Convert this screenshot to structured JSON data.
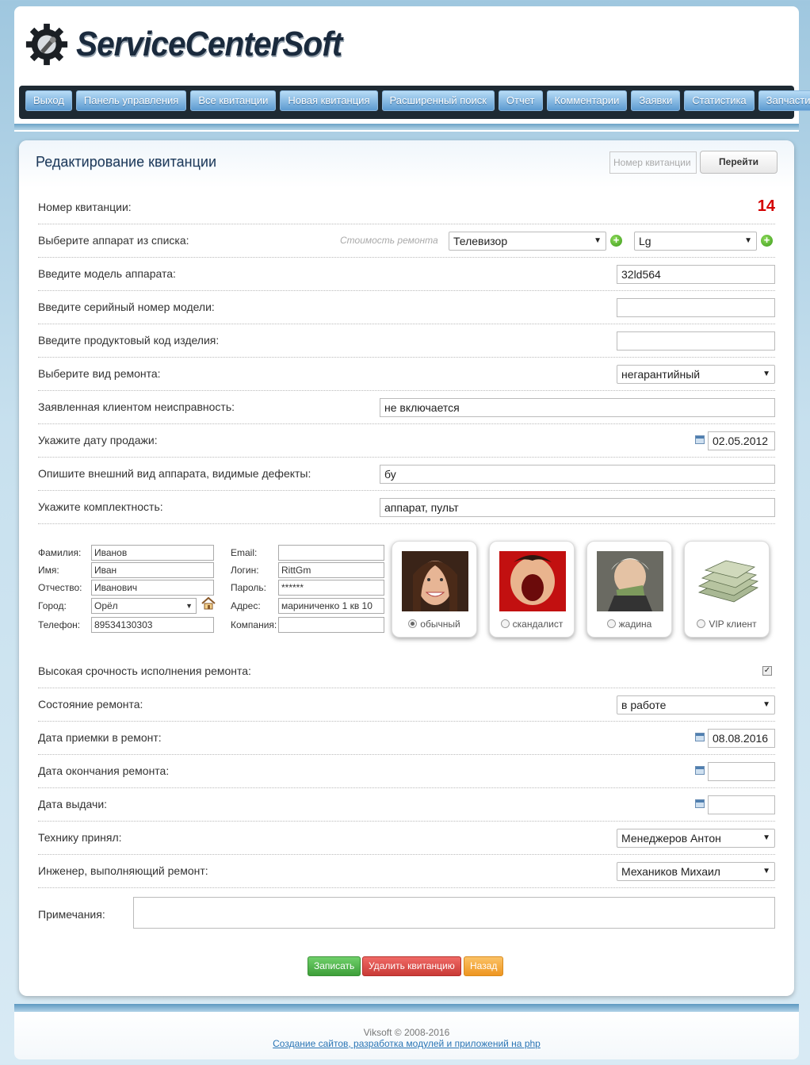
{
  "header": {
    "logo_text": "ServiceCenterSoft"
  },
  "nav": [
    "Выход",
    "Панель управления",
    "Все квитанции",
    "Новая квитанция",
    "Расширенный поиск",
    "Отчет",
    "Комментарии",
    "Заявки",
    "Статистика",
    "Запчасти"
  ],
  "page": {
    "title": "Редактирование квитанции",
    "jump_placeholder": "Номер квитанции",
    "jump_button": "Перейти"
  },
  "form": {
    "receipt_label": "Номер квитанции:",
    "receipt_number": "14",
    "device_label": "Выберите аппарат из списка:",
    "repair_cost_hint": "Стоимость ремонта",
    "device_type": "Телевизор",
    "device_brand": "Lg",
    "model_label": "Введите модель аппарата:",
    "model_value": "32ld564",
    "serial_label": "Введите серийный номер модели:",
    "serial_value": "",
    "product_code_label": "Введите продуктовый код изделия:",
    "product_code_value": "",
    "repair_type_label": "Выберите вид ремонта:",
    "repair_type_value": "негарантийный",
    "fault_label": "Заявленная клиентом неисправность:",
    "fault_value": "не включается",
    "sale_date_label": "Укажите дату продажи:",
    "sale_date_value": "02.05.2012",
    "appearance_label": "Опишите внешний вид аппарата, видимые дефекты:",
    "appearance_value": "бу",
    "kit_label": "Укажите комплектность:",
    "kit_value": "аппарат, пульт"
  },
  "client": {
    "surname_label": "Фамилия:",
    "surname": "Иванов",
    "name_label": "Имя:",
    "name": "Иван",
    "patronymic_label": "Отчество:",
    "patronymic": "Иванович",
    "city_label": "Город:",
    "city": "Орёл",
    "phone_label": "Телефон:",
    "phone": "89534130303",
    "email_label": "Email:",
    "email": "",
    "login_label": "Логин:",
    "login": "RittGm",
    "password_label": "Пароль:",
    "password": "******",
    "address_label": "Адрес:",
    "address": "мариниченко 1 кв 10",
    "company_label": "Компания:",
    "company": "",
    "types": [
      {
        "label": "обычный",
        "selected": true
      },
      {
        "label": "скандалист",
        "selected": false
      },
      {
        "label": "жадина",
        "selected": false
      },
      {
        "label": "VIP клиент",
        "selected": false
      }
    ]
  },
  "status": {
    "urgency_label": "Высокая срочность исполнения ремонта:",
    "urgency_checked": true,
    "state_label": "Состояние ремонта:",
    "state_value": "в работе",
    "accept_date_label": "Дата приемки в ремонт:",
    "accept_date_value": "08.08.2016",
    "finish_date_label": "Дата окончания ремонта:",
    "finish_date_value": "",
    "issue_date_label": "Дата выдачи:",
    "issue_date_value": "",
    "receiver_label": "Технику принял:",
    "receiver_value": "Менеджеров Антон",
    "engineer_label": "Инженер, выполняющий ремонт:",
    "engineer_value": "Механиков Михаил",
    "notes_label": "Примечания:"
  },
  "actions": {
    "save": "Записать",
    "delete": "Удалить квитанцию",
    "back": "Назад"
  },
  "footer": {
    "copyright": "Viksoft © 2008-2016",
    "link": "Создание сайтов, разработка модулей и приложений на php"
  }
}
